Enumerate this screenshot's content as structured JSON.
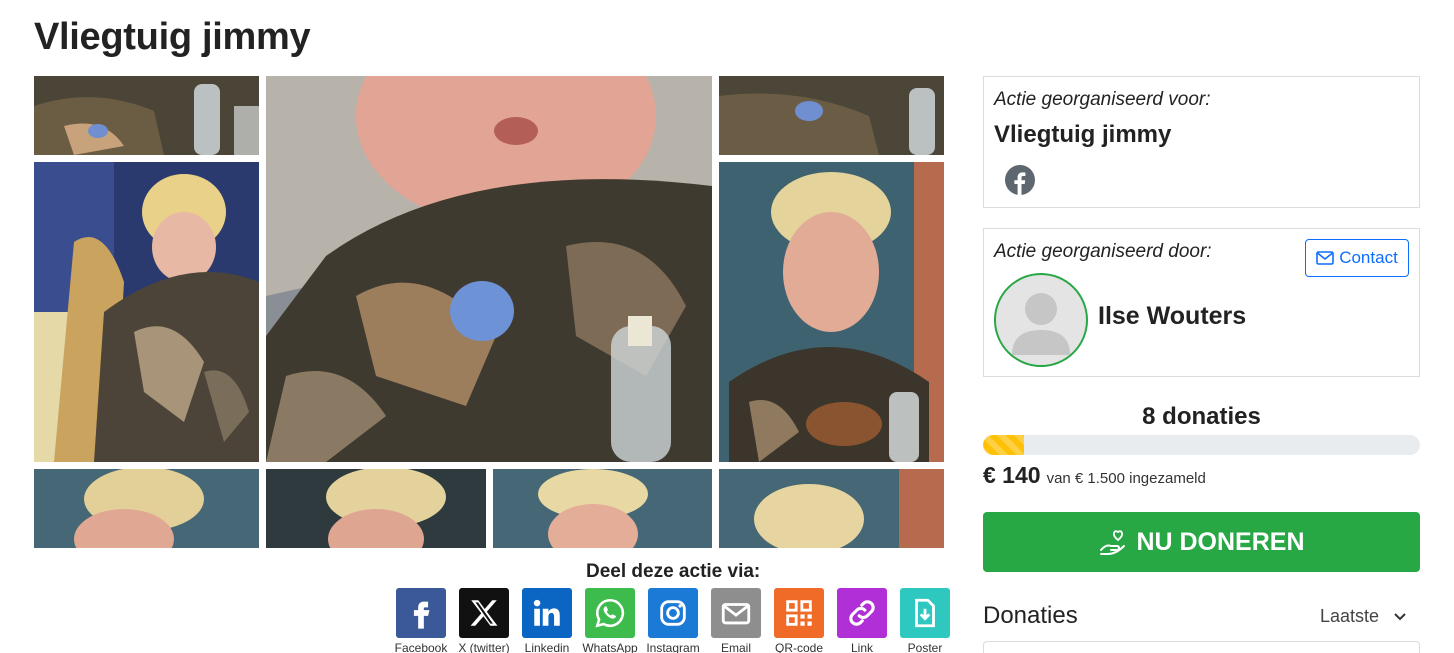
{
  "page": {
    "title": "Vliegtuig jimmy"
  },
  "share": {
    "title": "Deel deze actie via:",
    "items": [
      {
        "label": "Facebook",
        "icon": "facebook-icon",
        "color": "#3b5998"
      },
      {
        "label": "X (twitter)",
        "icon": "x-icon",
        "color": "#111111"
      },
      {
        "label": "Linkedin",
        "icon": "linkedin-icon",
        "color": "#0a66c2"
      },
      {
        "label": "WhatsApp",
        "icon": "whatsapp-icon",
        "color": "#3dbb4d"
      },
      {
        "label": "Instagram",
        "icon": "instagram-icon",
        "color": "#1b7ad6"
      },
      {
        "label": "Email",
        "icon": "email-icon",
        "color": "#8e8e8e"
      },
      {
        "label": "QR-code",
        "icon": "qr-code-icon",
        "color": "#f06a28"
      },
      {
        "label": "Link",
        "icon": "link-icon",
        "color": "#b02fd6"
      },
      {
        "label": "Poster",
        "icon": "poster-icon",
        "color": "#2fc8c0"
      }
    ]
  },
  "organised_for": {
    "caption": "Actie georganiseerd voor:",
    "name": "Vliegtuig jimmy"
  },
  "organised_by": {
    "caption": "Actie georganiseerd door:",
    "name": "Ilse Wouters",
    "contact_label": "Contact"
  },
  "progress": {
    "donations_text": "8 donaties",
    "raised": "€ 140",
    "goal_text": "van € 1.500 ingezameld",
    "fraction": 0.093
  },
  "donate_button": {
    "label": "NU DONEREN"
  },
  "donations_list": {
    "heading": "Donaties",
    "sort_selected": "Laatste"
  },
  "colors": {
    "accent": "#28a745",
    "contact": "#0d6efd",
    "progress": "#ffc107"
  }
}
